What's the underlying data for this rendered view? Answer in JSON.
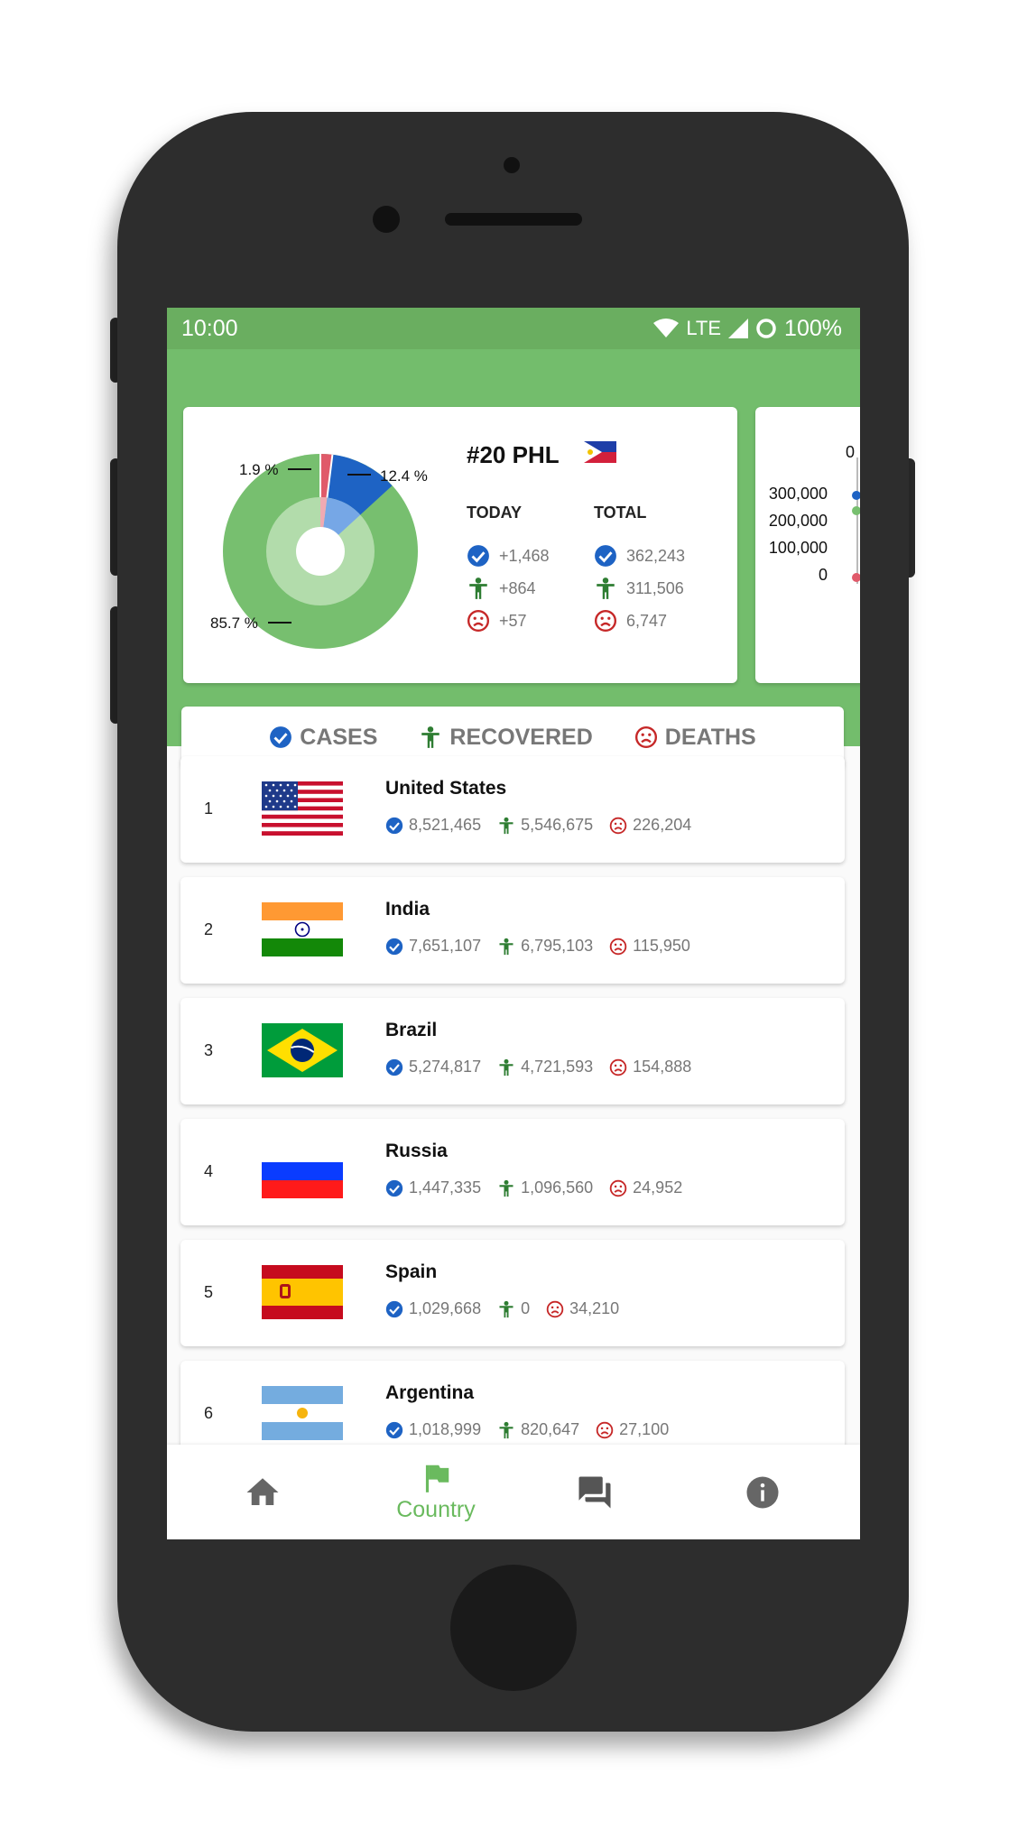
{
  "status_bar": {
    "time": "10:00",
    "network": "LTE",
    "battery": "100%"
  },
  "summary": {
    "title": "#20 PHL",
    "today_label": "TODAY",
    "total_label": "TOTAL",
    "today": {
      "cases": "+1,468",
      "recovered": "+864",
      "deaths": "+57"
    },
    "total": {
      "cases": "362,243",
      "recovered": "311,506",
      "deaths": "6,747"
    },
    "pie": {
      "recovered_pct": "85.7 %",
      "cases_pct": "12.4 %",
      "deaths_pct": "1.9 %"
    }
  },
  "second_chart": {
    "labels": [
      "0",
      "300,000",
      "200,000",
      "100,000",
      "0"
    ]
  },
  "filters": {
    "cases": "CASES",
    "recovered": "RECOVERED",
    "deaths": "DEATHS"
  },
  "countries": [
    {
      "rank": "1",
      "name": "United States",
      "cases": "8,521,465",
      "recovered": "5,546,675",
      "deaths": "226,204"
    },
    {
      "rank": "2",
      "name": "India",
      "cases": "7,651,107",
      "recovered": "6,795,103",
      "deaths": "115,950"
    },
    {
      "rank": "3",
      "name": "Brazil",
      "cases": "5,274,817",
      "recovered": "4,721,593",
      "deaths": "154,888"
    },
    {
      "rank": "4",
      "name": "Russia",
      "cases": "1,447,335",
      "recovered": "1,096,560",
      "deaths": "24,952"
    },
    {
      "rank": "5",
      "name": "Spain",
      "cases": "1,029,668",
      "recovered": "0",
      "deaths": "34,210"
    },
    {
      "rank": "6",
      "name": "Argentina",
      "cases": "1,018,999",
      "recovered": "820,647",
      "deaths": "27,100"
    }
  ],
  "nav": {
    "country_label": "Country"
  },
  "colors": {
    "green": "#73bd6c",
    "blue": "#1e63c4",
    "dark_green": "#2e7d32",
    "red": "#c62828"
  }
}
